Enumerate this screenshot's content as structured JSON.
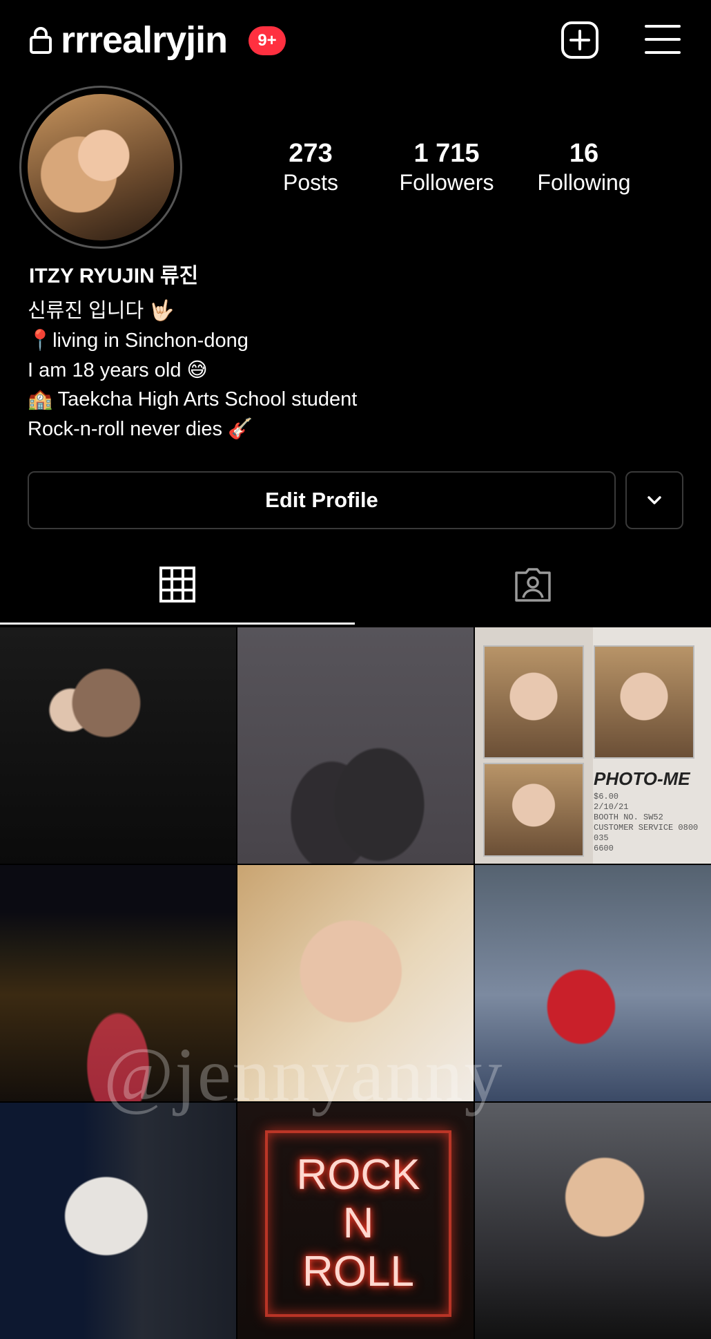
{
  "header": {
    "username": "rrrealryjin",
    "notification_badge": "9+",
    "icons": {
      "lock": "lock-icon",
      "add": "plus-square-icon",
      "menu": "hamburger-menu-icon"
    }
  },
  "stats": [
    {
      "number": "273",
      "label": "Posts"
    },
    {
      "number": "1 715",
      "label": "Followers"
    },
    {
      "number": "16",
      "label": "Following"
    }
  ],
  "profile": {
    "display_name": "ITZY RYUJIN 류진",
    "bio": [
      "신류진 입니다 🤟🏻",
      "📍living in Sinchon-dong",
      "I am 18 years old 😅",
      "🏫 Taekcha High Arts School student",
      "Rock-n-roll never dies 🎸"
    ]
  },
  "actions": {
    "edit_profile_label": "Edit Profile"
  },
  "tabs": [
    {
      "icon": "grid-icon",
      "active": true
    },
    {
      "icon": "tagged-person-icon",
      "active": false
    }
  ],
  "posts": {
    "neon_sign": [
      "ROCK",
      "N",
      "ROLL"
    ],
    "photo_strip_title": "PHOTO-ME",
    "photo_strip_receipt": [
      "$6.00",
      "2/10/21",
      "BOOTH NO. SW52",
      "CUSTOMER SERVICE 0800 035",
      "6600"
    ],
    "watermark": "@jennyanny"
  },
  "colors": {
    "background": "#000000",
    "badge": "#ff3040",
    "text": "#ffffff",
    "border": "#3a3a3a"
  }
}
